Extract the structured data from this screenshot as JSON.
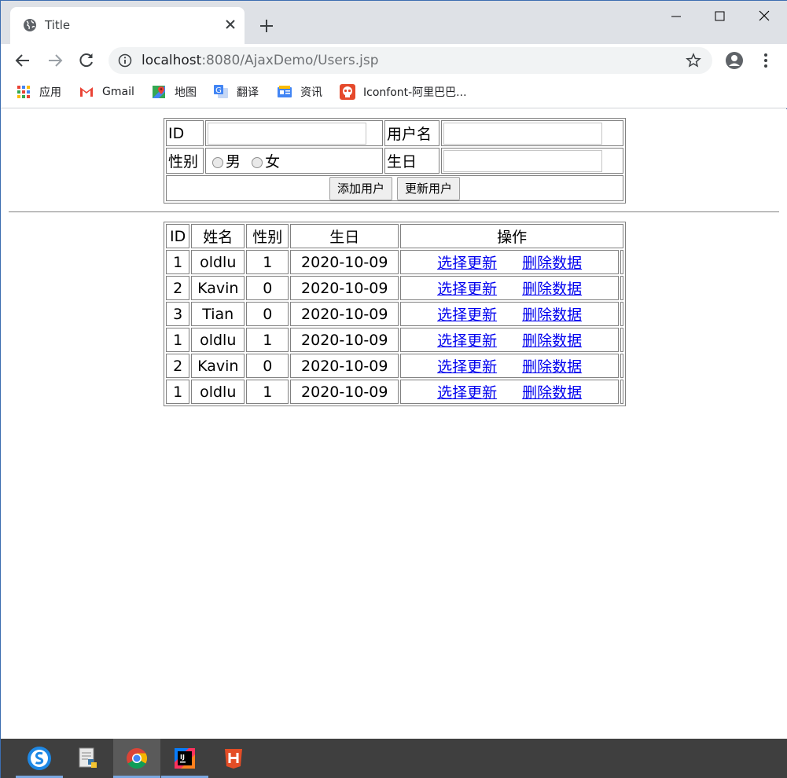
{
  "window": {
    "tab_title": "Title",
    "url_host": "localhost",
    "url_rest": ":8080/AjaxDemo/Users.jsp"
  },
  "bookmarks": [
    {
      "label": "应用",
      "icon": "apps-grid-icon"
    },
    {
      "label": "Gmail",
      "icon": "gmail-icon"
    },
    {
      "label": "地图",
      "icon": "maps-icon"
    },
    {
      "label": "翻译",
      "icon": "translate-icon"
    },
    {
      "label": "资讯",
      "icon": "news-icon"
    },
    {
      "label": "Iconfont-阿里巴巴...",
      "icon": "iconfont-icon"
    }
  ],
  "form": {
    "id_label": "ID",
    "id_value": "",
    "username_label": "用户名",
    "username_value": "",
    "gender_label": "性别",
    "gender_male": "男",
    "gender_female": "女",
    "birthday_label": "生日",
    "birthday_value": "",
    "add_button": "添加用户",
    "update_button": "更新用户"
  },
  "table": {
    "headers": [
      "ID",
      "姓名",
      "性别",
      "生日",
      "操作"
    ],
    "select_update_label": "选择更新",
    "delete_label": "删除数据",
    "rows": [
      {
        "id": "1",
        "name": "oldlu",
        "gender": "1",
        "birthday": "2020-10-09"
      },
      {
        "id": "2",
        "name": "Kavin",
        "gender": "0",
        "birthday": "2020-10-09"
      },
      {
        "id": "3",
        "name": "Tian",
        "gender": "0",
        "birthday": "2020-10-09"
      },
      {
        "id": "1",
        "name": "oldlu",
        "gender": "1",
        "birthday": "2020-10-09"
      },
      {
        "id": "2",
        "name": "Kavin",
        "gender": "0",
        "birthday": "2020-10-09"
      },
      {
        "id": "1",
        "name": "oldlu",
        "gender": "1",
        "birthday": "2020-10-09"
      }
    ]
  },
  "taskbar": [
    "sogou-input-icon",
    "notepad-python-icon",
    "chrome-icon",
    "intellij-idea-icon",
    "html-h-icon"
  ],
  "colors": {
    "link": "#0000ee",
    "taskbar": "#3f3f3f",
    "tabstrip": "#dee1e6"
  }
}
